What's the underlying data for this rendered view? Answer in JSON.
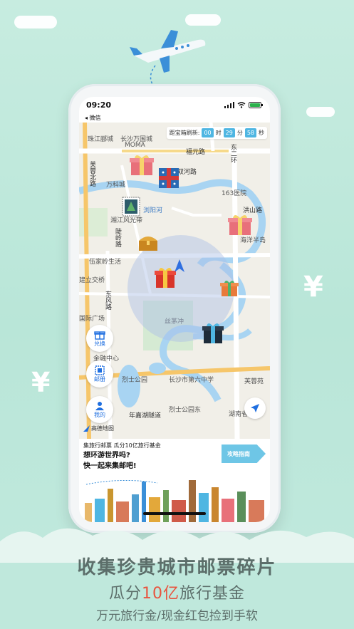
{
  "status": {
    "time": "09:20"
  },
  "wechat": {
    "back_label": "◂ 微信"
  },
  "timer": {
    "label": "距宝箱刷新:",
    "hours": "00",
    "hours_unit": "时",
    "minutes": "29",
    "minutes_unit": "分",
    "seconds": "58",
    "seconds_unit": "秒"
  },
  "map_labels": {
    "zhujiang": "珠江郦城",
    "wanguo": "长沙万国城",
    "moma": "MOMA",
    "fuyuan": "福元路",
    "dongerhuan": "东二环",
    "furong_north": "芙蓉北路",
    "wanke": "万科城",
    "shuanghe": "双河路",
    "hospital": "163医院",
    "xiangjiang": "湘江风光带",
    "liuyang_river": "浏阳河",
    "hongshan": "洪山路",
    "qiling": "陡岭路",
    "haiyang": "海洋半岛",
    "wujialing": "伍家岭生活",
    "lijiaoqiao": "建立交桥",
    "dongfeng": "东风路",
    "guoji": "国际广场",
    "simaochong": "丝茅冲",
    "jinrong": "金融中心",
    "lieshi": "烈士公园",
    "school6": "长沙市第六中学",
    "furongyuan": "芙蓉苑",
    "nianjia": "年嘉湖隧道",
    "lieshi_east": "烈士公园东",
    "hunan": "湖南省",
    "amap": "高德地图"
  },
  "side_buttons": {
    "exchange": "兑换",
    "post": "邮册",
    "mine": "我的"
  },
  "promo": {
    "small": "集旅行邮票 瓜分10亿旅行基金",
    "line1": "想环游世界吗?",
    "line2": "快一起来集邮吧!",
    "guide": "攻略指南"
  },
  "tagline": {
    "line1": "收集珍贵城市邮票碎片",
    "line2_prefix": "瓜分",
    "line2_highlight": "10亿",
    "line2_suffix": "旅行基金",
    "line3": "万元旅行金/现金红包捡到手软"
  },
  "colors": {
    "accent_blue": "#4fb6e2",
    "bg_mint": "#bfe8dc",
    "highlight_red": "#e8543e",
    "text_gray": "#5c6e6a"
  }
}
